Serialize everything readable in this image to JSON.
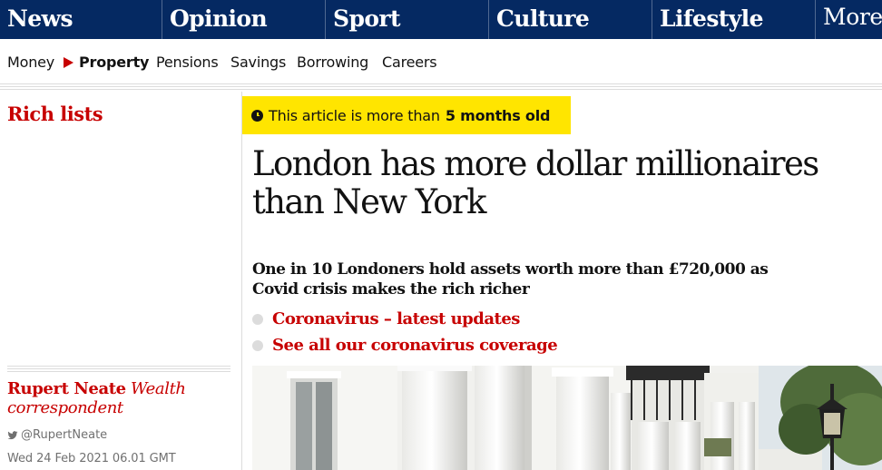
{
  "top_nav": {
    "pillars": [
      "News",
      "Opinion",
      "Sport",
      "Culture",
      "Lifestyle"
    ],
    "more_label": "More"
  },
  "sub_nav": {
    "items": [
      "Money",
      "Property",
      "Pensions",
      "Savings",
      "Borrowing",
      "Careers"
    ],
    "active": "Property"
  },
  "series": "Rich lists",
  "age_warning": {
    "prefix": "This article is more than",
    "age": "5 months old"
  },
  "headline": "London has more dollar millionaires than New York",
  "standfirst": "One in 10 Londoners hold assets worth more than £720,000 as Covid crisis makes the rich richer",
  "related_links": [
    "Coronavirus – latest updates",
    "See all our coronavirus coverage"
  ],
  "byline": {
    "author": "Rupert Neate",
    "role": "Wealth correspondent",
    "twitter": "@RupertNeate"
  },
  "dateline": "Wed 24 Feb 2021 06.01 GMT",
  "colors": {
    "brand": "#052962",
    "accent": "#c70000",
    "age_warning": "#ffe500"
  }
}
